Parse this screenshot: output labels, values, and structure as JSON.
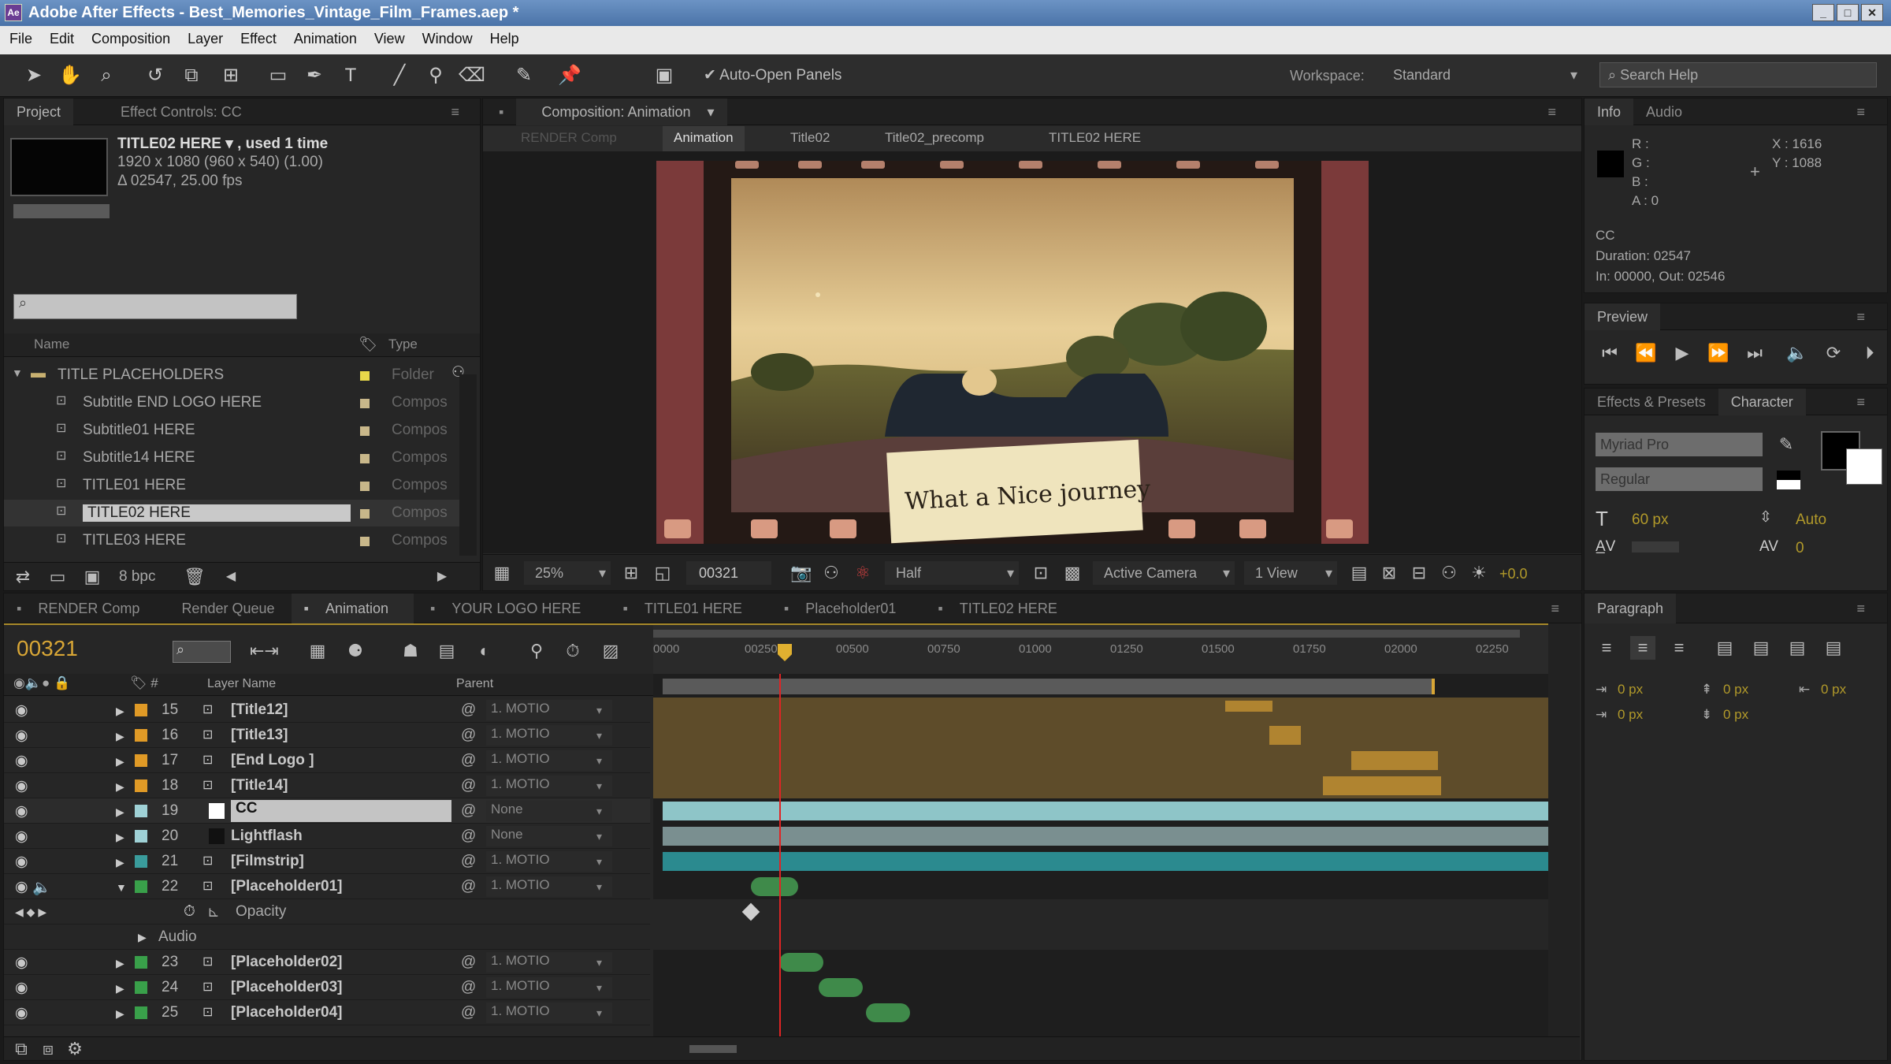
{
  "app": {
    "title": "Adobe After Effects - Best_Memories_Vintage_Film_Frames.aep *"
  },
  "menu": [
    "File",
    "Edit",
    "Composition",
    "Layer",
    "Effect",
    "Animation",
    "View",
    "Window",
    "Help"
  ],
  "toolbar": {
    "auto_open": "Auto-Open Panels",
    "workspace_label": "Workspace:",
    "workspace_value": "Standard",
    "search_placeholder": "Search Help"
  },
  "project": {
    "tabs": [
      "Project",
      "Effect Controls: CC"
    ],
    "item_name": "TITLE02 HERE ▾ , used 1 time",
    "item_dims": "1920 x 1080 (960 x 540) (1.00)",
    "item_dur": "Δ 02547, 25.00 fps",
    "col_name": "Name",
    "col_type": "Type",
    "items": [
      {
        "name": "TITLE PLACEHOLDERS",
        "type": "Folder",
        "color": "#e8d84a"
      },
      {
        "name": "Subtitle END LOGO HERE",
        "type": "Compos",
        "color": "#c8b78a"
      },
      {
        "name": "Subtitle01 HERE",
        "type": "Compos",
        "color": "#c8b78a"
      },
      {
        "name": "Subtitle14 HERE",
        "type": "Compos",
        "color": "#c8b78a"
      },
      {
        "name": "TITLE01 HERE",
        "type": "Compos",
        "color": "#c8b78a"
      },
      {
        "name": "TITLE02 HERE",
        "type": "Compos",
        "color": "#c8b78a"
      },
      {
        "name": "TITLE03 HERE",
        "type": "Compos",
        "color": "#c8b78a"
      }
    ],
    "bpc": "8 bpc"
  },
  "comp": {
    "tab": "Composition: Animation",
    "crumbs": [
      "RENDER Comp",
      "Animation",
      "Title02",
      "Title02_precomp",
      "TITLE02 HERE"
    ],
    "note": "What a Nice journey",
    "zoom": "25%",
    "timecode": "00321",
    "resolution": "Half",
    "camera": "Active Camera",
    "views": "1 View",
    "exposure": "+0.0"
  },
  "info": {
    "tabs": [
      "Info",
      "Audio"
    ],
    "r": "R :",
    "g": "G :",
    "b": "B :",
    "a": "A : 0",
    "x": "X : 1616",
    "y": "Y : 1088",
    "layer": "CC",
    "duration": "Duration: 02547",
    "inout": "In: 00000, Out: 02546"
  },
  "preview": {
    "tab": "Preview"
  },
  "character": {
    "tabs": [
      "Effects & Presets",
      "Character"
    ],
    "font": "Myriad Pro",
    "style": "Regular",
    "size": "60 px",
    "leading": "Auto",
    "tracking": "0"
  },
  "paragraph": {
    "tab": "Paragraph",
    "values": [
      "0 px",
      "0 px",
      "0 px",
      "0 px",
      "0 px"
    ]
  },
  "timeline": {
    "tabs": [
      "RENDER Comp",
      "Render Queue",
      "Animation",
      "YOUR LOGO HERE",
      "TITLE01 HERE",
      "Placeholder01",
      "TITLE02 HERE"
    ],
    "timecode": "00321",
    "col_layer": "Layer Name",
    "col_parent": "Parent",
    "ruler": [
      "0000",
      "00250",
      "00500",
      "00750",
      "01000",
      "01250",
      "01500",
      "01750",
      "02000",
      "02250"
    ],
    "layers": [
      {
        "num": "15",
        "name": "[Title12]",
        "parent": "1. MOTIO",
        "label": "#e09a26"
      },
      {
        "num": "16",
        "name": "[Title13]",
        "parent": "1. MOTIO",
        "label": "#e09a26"
      },
      {
        "num": "17",
        "name": "[End Logo ]",
        "parent": "1. MOTIO",
        "label": "#e09a26"
      },
      {
        "num": "18",
        "name": "[Title14]",
        "parent": "1. MOTIO",
        "label": "#e09a26"
      },
      {
        "num": "19",
        "name": "CC",
        "parent": "None",
        "label": "#9fd1d6"
      },
      {
        "num": "20",
        "name": "Lightflash",
        "parent": "None",
        "label": "#9fd1d6"
      },
      {
        "num": "21",
        "name": "[Filmstrip]",
        "parent": "1. MOTIO",
        "label": "#3a9c9c"
      },
      {
        "num": "22",
        "name": "[Placeholder01]",
        "parent": "1. MOTIO",
        "label": "#39a04a"
      },
      {
        "num": "23",
        "name": "[Placeholder02]",
        "parent": "1. MOTIO",
        "label": "#39a04a"
      },
      {
        "num": "24",
        "name": "[Placeholder03]",
        "parent": "1. MOTIO",
        "label": "#39a04a"
      },
      {
        "num": "25",
        "name": "[Placeholder04]",
        "parent": "1. MOTIO",
        "label": "#39a04a"
      }
    ],
    "sub_opacity": "Opacity",
    "sub_audio": "Audio"
  }
}
